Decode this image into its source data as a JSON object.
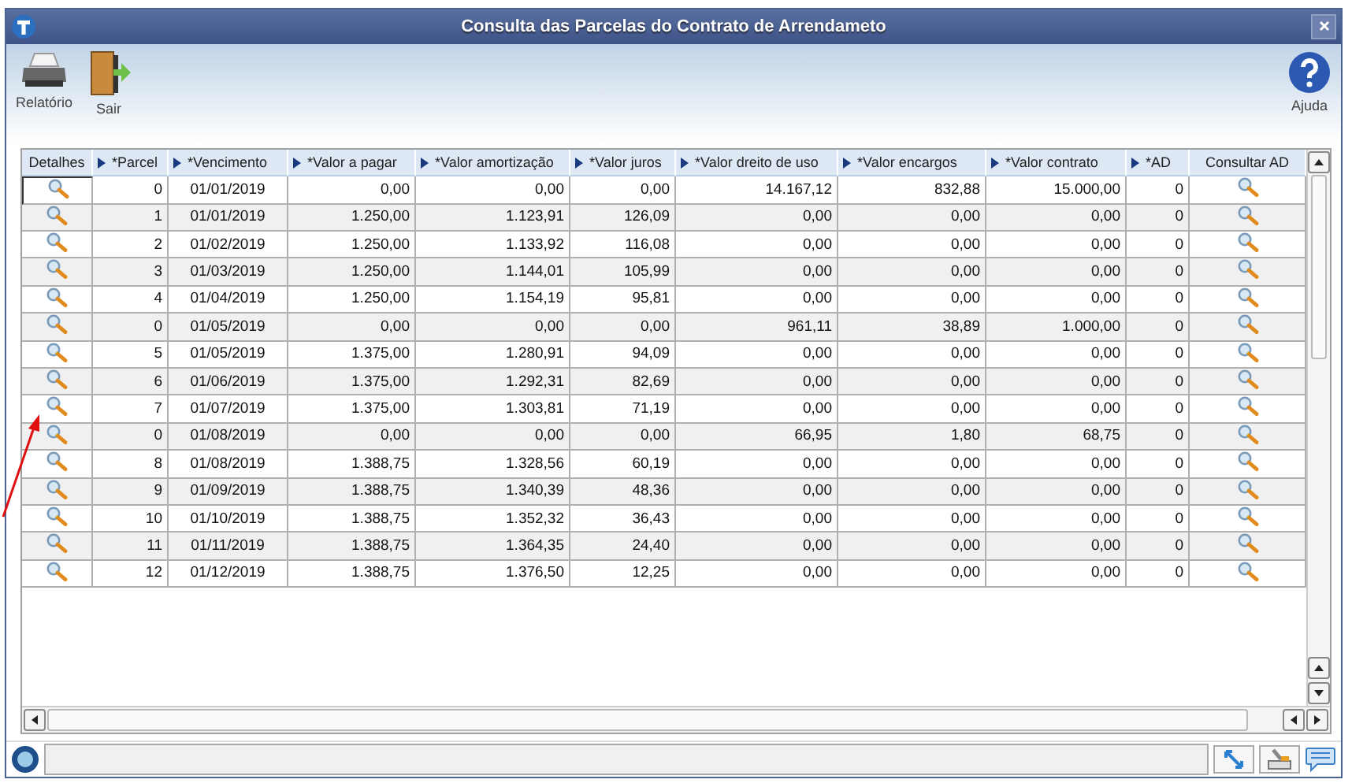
{
  "window": {
    "title": "Consulta das Parcelas do Contrato de Arrendameto"
  },
  "toolbar": [
    {
      "label": "Relatório",
      "kind": "printer"
    },
    {
      "label": "Sair",
      "kind": "exit"
    }
  ],
  "help": {
    "label": "Ajuda"
  },
  "table": {
    "details_header": "Detalhes",
    "consult_header": "Consultar AD",
    "columns": [
      {
        "label": "*Parcel",
        "sort_marker": true
      },
      {
        "label": "*Vencimento",
        "sort_marker": true
      },
      {
        "label": "*Valor a pagar",
        "sort_marker": true
      },
      {
        "label": "*Valor amortização",
        "sort_marker": true
      },
      {
        "label": "*Valor juros",
        "sort_marker": true
      },
      {
        "label": "*Valor dreito de uso",
        "sort_marker": true
      },
      {
        "label": "*Valor encargos",
        "sort_marker": true
      },
      {
        "label": "*Valor contrato",
        "sort_marker": true
      },
      {
        "label": "*AD",
        "sort_marker": true
      }
    ],
    "rows": [
      {
        "focused": true,
        "cells": [
          "0",
          "01/01/2019",
          "0,00",
          "0,00",
          "0,00",
          "14.167,12",
          "832,88",
          "15.000,00",
          "0"
        ]
      },
      {
        "focused": false,
        "cells": [
          "1",
          "01/01/2019",
          "1.250,00",
          "1.123,91",
          "126,09",
          "0,00",
          "0,00",
          "0,00",
          "0"
        ]
      },
      {
        "focused": false,
        "cells": [
          "2",
          "01/02/2019",
          "1.250,00",
          "1.133,92",
          "116,08",
          "0,00",
          "0,00",
          "0,00",
          "0"
        ]
      },
      {
        "focused": false,
        "cells": [
          "3",
          "01/03/2019",
          "1.250,00",
          "1.144,01",
          "105,99",
          "0,00",
          "0,00",
          "0,00",
          "0"
        ]
      },
      {
        "focused": false,
        "cells": [
          "4",
          "01/04/2019",
          "1.250,00",
          "1.154,19",
          "95,81",
          "0,00",
          "0,00",
          "0,00",
          "0"
        ]
      },
      {
        "focused": false,
        "cells": [
          "0",
          "01/05/2019",
          "0,00",
          "0,00",
          "0,00",
          "961,11",
          "38,89",
          "1.000,00",
          "0"
        ]
      },
      {
        "focused": false,
        "cells": [
          "5",
          "01/05/2019",
          "1.375,00",
          "1.280,91",
          "94,09",
          "0,00",
          "0,00",
          "0,00",
          "0"
        ]
      },
      {
        "focused": false,
        "cells": [
          "6",
          "01/06/2019",
          "1.375,00",
          "1.292,31",
          "82,69",
          "0,00",
          "0,00",
          "0,00",
          "0"
        ]
      },
      {
        "focused": false,
        "cells": [
          "7",
          "01/07/2019",
          "1.375,00",
          "1.303,81",
          "71,19",
          "0,00",
          "0,00",
          "0,00",
          "0"
        ]
      },
      {
        "focused": false,
        "cells": [
          "0",
          "01/08/2019",
          "0,00",
          "0,00",
          "0,00",
          "66,95",
          "1,80",
          "68,75",
          "0"
        ]
      },
      {
        "focused": false,
        "cells": [
          "8",
          "01/08/2019",
          "1.388,75",
          "1.328,56",
          "60,19",
          "0,00",
          "0,00",
          "0,00",
          "0"
        ]
      },
      {
        "focused": false,
        "cells": [
          "9",
          "01/09/2019",
          "1.388,75",
          "1.340,39",
          "48,36",
          "0,00",
          "0,00",
          "0,00",
          "0"
        ]
      },
      {
        "focused": false,
        "cells": [
          "10",
          "01/10/2019",
          "1.388,75",
          "1.352,32",
          "36,43",
          "0,00",
          "0,00",
          "0,00",
          "0"
        ]
      },
      {
        "focused": false,
        "cells": [
          "11",
          "01/11/2019",
          "1.388,75",
          "1.364,35",
          "24,40",
          "0,00",
          "0,00",
          "0,00",
          "0"
        ]
      },
      {
        "focused": false,
        "cells": [
          "12",
          "01/12/2019",
          "1.388,75",
          "1.376,50",
          "12,25",
          "0,00",
          "0,00",
          "0,00",
          "0"
        ]
      }
    ]
  }
}
